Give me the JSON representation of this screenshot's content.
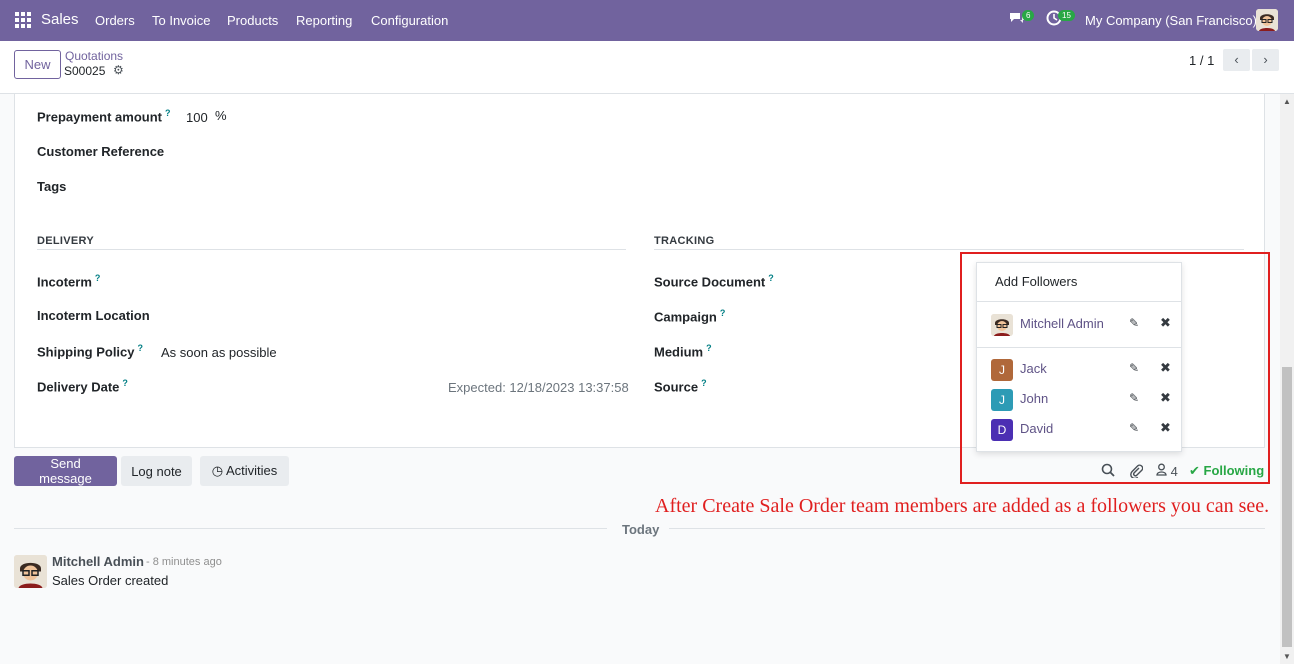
{
  "navbar": {
    "app_name": "Sales",
    "menu": [
      "Orders",
      "To Invoice",
      "Products",
      "Reporting",
      "Configuration"
    ],
    "messages_count": "6",
    "activities_count": "15",
    "company": "My Company (San Francisco)",
    "bg_color": "#71639e"
  },
  "control": {
    "new_label": "New",
    "breadcrumb": "Quotations",
    "record_name": "S00025",
    "pager": "1 / 1"
  },
  "form": {
    "prepayment_label": "Prepayment amount",
    "help_mark": "?",
    "prepayment_value": "100",
    "prepayment_unit": "%",
    "customer_ref_label": "Customer Reference",
    "tags_label": "Tags",
    "delivery_section": "DELIVERY",
    "incoterm_label": "Incoterm",
    "incoterm_location_label": "Incoterm Location",
    "shipping_policy_label": "Shipping Policy",
    "shipping_policy_value": "As soon as possible",
    "delivery_date_label": "Delivery Date",
    "delivery_expected": "Expected: 12/18/2023 13:37:58",
    "tracking_section": "TRACKING",
    "source_document_label": "Source Document",
    "campaign_label": "Campaign",
    "medium_label": "Medium",
    "source_label": "Source"
  },
  "chatter": {
    "send_message": "Send message",
    "log_note": "Log note",
    "activities": "Activities",
    "followers_count": "4",
    "following": "Following",
    "today": "Today",
    "messages": [
      {
        "author": "Mitchell Admin",
        "time": "- 8 minutes ago",
        "body": "Sales Order created"
      }
    ]
  },
  "followers_dropdown": {
    "add_followers": "Add Followers",
    "followers": [
      {
        "name": "Mitchell Admin",
        "initial": "",
        "color": "#e9e2d6"
      },
      {
        "name": "Jack",
        "initial": "J",
        "color": "#b0683a"
      },
      {
        "name": "John",
        "initial": "J",
        "color": "#2d9bb5"
      },
      {
        "name": "David",
        "initial": "D",
        "color": "#4b2fb3"
      }
    ]
  },
  "annotation": {
    "text": "After Create Sale Order team members are added as a followers you can see.",
    "color": "#e01f1f"
  }
}
